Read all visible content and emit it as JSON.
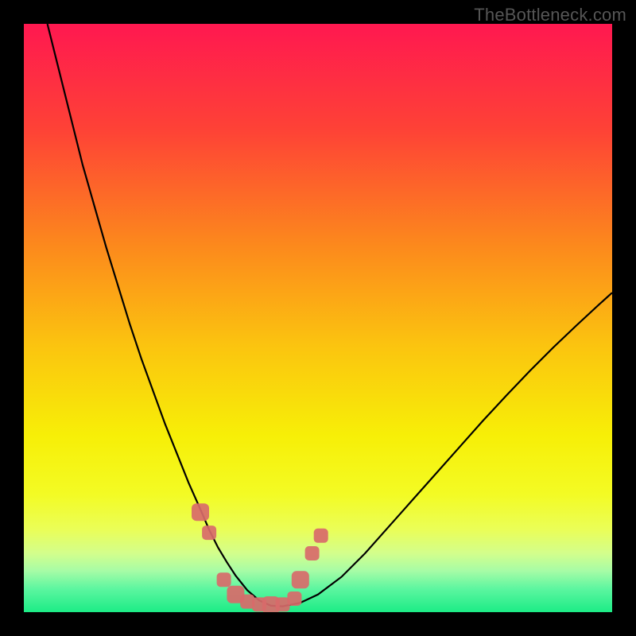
{
  "watermark": "TheBottleneck.com",
  "colors": {
    "frame": "#000000",
    "curve": "#000000",
    "marker_fill": "#d86a6a",
    "marker_stroke": "#d86a6a",
    "gradient_stops": [
      {
        "offset": 0.0,
        "color": "#ff1850"
      },
      {
        "offset": 0.18,
        "color": "#fe4236"
      },
      {
        "offset": 0.38,
        "color": "#fc8a1c"
      },
      {
        "offset": 0.55,
        "color": "#fbc50f"
      },
      {
        "offset": 0.7,
        "color": "#f7ef07"
      },
      {
        "offset": 0.8,
        "color": "#f3fb24"
      },
      {
        "offset": 0.86,
        "color": "#eafe58"
      },
      {
        "offset": 0.9,
        "color": "#d3fe8c"
      },
      {
        "offset": 0.93,
        "color": "#a6fca6"
      },
      {
        "offset": 0.96,
        "color": "#5df6a0"
      },
      {
        "offset": 1.0,
        "color": "#1cec86"
      }
    ]
  },
  "chart_data": {
    "type": "line",
    "title": "",
    "xlabel": "",
    "ylabel": "",
    "xlim": [
      0,
      100
    ],
    "ylim": [
      0,
      100
    ],
    "series": [
      {
        "name": "bottleneck-curve",
        "x": [
          4,
          6,
          8,
          10,
          12,
          14,
          16,
          18,
          20,
          22,
          24,
          26,
          28,
          30,
          31.5,
          33,
          34.5,
          36,
          38,
          40,
          42,
          44,
          47,
          50,
          54,
          58,
          62,
          66,
          70,
          74,
          78,
          82,
          86,
          90,
          94,
          98,
          100
        ],
        "y": [
          100,
          92,
          84,
          76,
          69,
          62,
          55.5,
          49,
          43,
          37.5,
          32,
          27,
          22,
          17.5,
          14,
          11,
          8.5,
          6.2,
          3.7,
          2.0,
          1.1,
          1.0,
          1.6,
          3.0,
          6.0,
          10.0,
          14.5,
          19.0,
          23.5,
          28.0,
          32.5,
          36.8,
          41.0,
          45.0,
          48.8,
          52.5,
          54.3
        ]
      }
    ],
    "markers": {
      "name": "highlighted-points",
      "points": [
        {
          "x": 30.0,
          "y": 17.0
        },
        {
          "x": 31.5,
          "y": 13.5
        },
        {
          "x": 34.0,
          "y": 5.5
        },
        {
          "x": 36.0,
          "y": 3.0
        },
        {
          "x": 38.0,
          "y": 1.8
        },
        {
          "x": 40.0,
          "y": 1.3
        },
        {
          "x": 42.0,
          "y": 1.2
        },
        {
          "x": 44.0,
          "y": 1.3
        },
        {
          "x": 46.0,
          "y": 2.3
        },
        {
          "x": 47.0,
          "y": 5.5
        },
        {
          "x": 49.0,
          "y": 10.0
        },
        {
          "x": 50.5,
          "y": 13.0
        }
      ]
    }
  }
}
